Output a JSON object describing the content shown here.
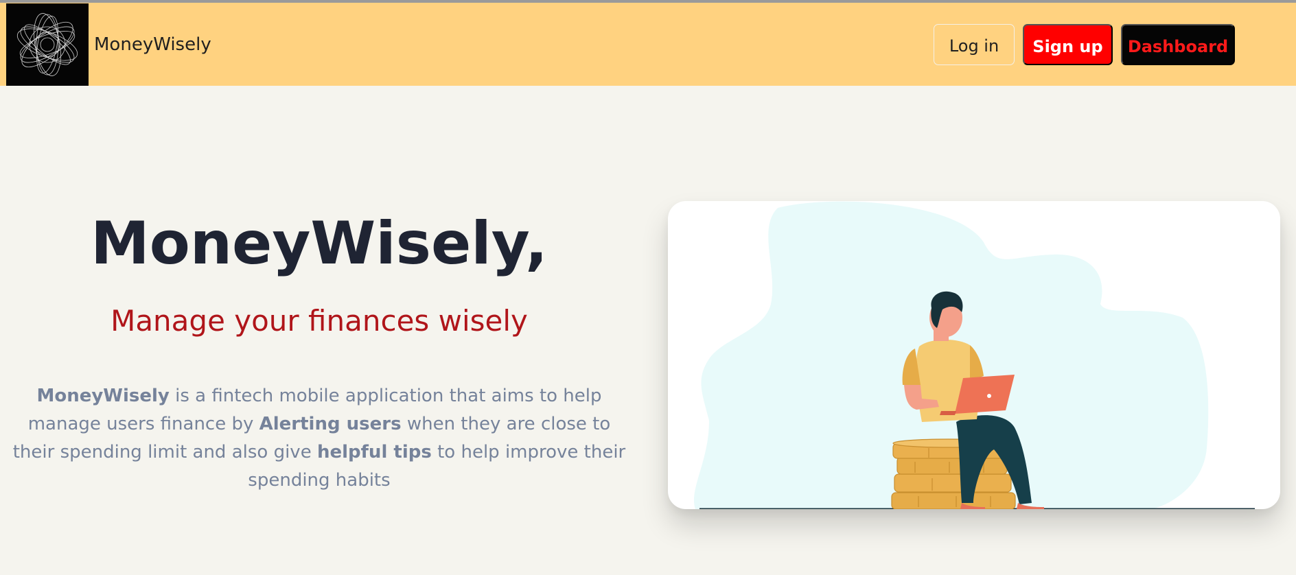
{
  "navbar": {
    "brand": "MoneyWisely",
    "login_label": "Log in",
    "signup_label": "Sign up",
    "dashboard_label": "Dashboard"
  },
  "hero": {
    "title": "MoneyWisely,",
    "subtitle": "Manage your finances wisely",
    "description": {
      "bold1": "MoneyWisely",
      "text1": " is a fintech mobile application that aims to help manage users finance by ",
      "bold2": "Alerting users",
      "text2": " when they are close to their spending limit and also give ",
      "bold3": "helpful tips",
      "text3": " to help improve their spending habits"
    }
  },
  "icons": {
    "logo": "spiral-logo-icon",
    "illustration": "person-with-laptop-on-coins-illustration"
  },
  "colors": {
    "navbar_bg": "#ffd280",
    "page_bg": "#f5f4ee",
    "signup_bg": "#ff0000",
    "dashboard_bg": "#050505",
    "dashboard_text": "#ff1a1a",
    "subtitle": "#b0151a",
    "description": "#75829a"
  }
}
